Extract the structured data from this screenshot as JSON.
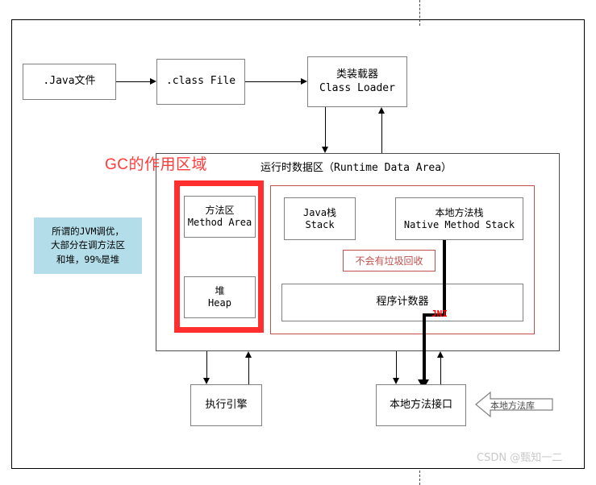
{
  "diagram": {
    "title_label": "GC的作用区域",
    "runtime_area_label": "运行时数据区（Runtime Data Area）",
    "watermark": "CSDN @甄知一二",
    "jni_label": "JNI",
    "no_gc_label": "不会有垃圾回收",
    "native_library_label": "本地方法库"
  },
  "colors": {
    "gc_red": "#ff2f2f",
    "accent_red": "#c0504d",
    "note_blue": "#b3dde8",
    "box_border": "#808080",
    "jni_red": "#ff0000"
  },
  "nodes": {
    "java_file": {
      "line1": ".Java文件",
      "line2": ""
    },
    "class_file": {
      "line1": ".class File",
      "line2": ""
    },
    "class_loader": {
      "line1": "类装载器",
      "line2": "Class Loader"
    },
    "method_area": {
      "line1": "方法区",
      "line2": "Method Area"
    },
    "heap": {
      "line1": "堆",
      "line2": "Heap"
    },
    "java_stack": {
      "line1": "Java栈",
      "line2": "Stack"
    },
    "native_method_stack": {
      "line1": "本地方法栈",
      "line2": "Native Method Stack"
    },
    "program_counter": {
      "line1": "程序计数器",
      "line2": ""
    },
    "execution_engine": {
      "line1": "执行引擎",
      "line2": ""
    },
    "native_method_interface": {
      "line1": "本地方法接口",
      "line2": ""
    }
  },
  "note": {
    "line1": "所谓的JVM调优，",
    "line2": "大部分在调方法区",
    "line3": "和堆，99%是堆"
  }
}
